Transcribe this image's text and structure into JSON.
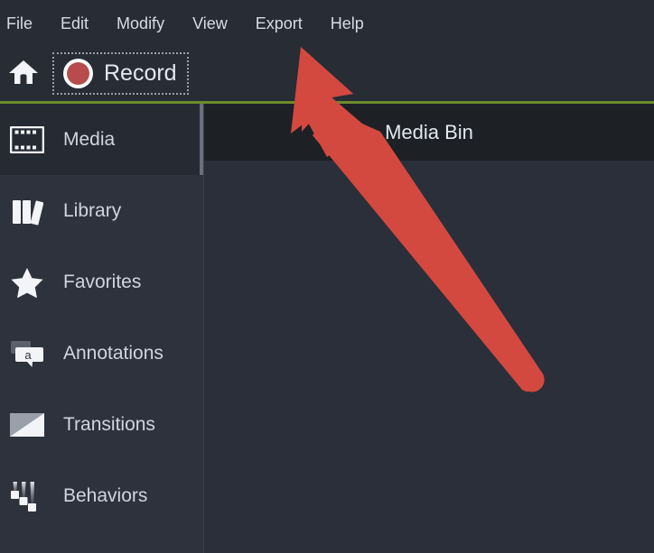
{
  "menubar": {
    "items": [
      {
        "label": "File"
      },
      {
        "label": "Edit"
      },
      {
        "label": "Modify"
      },
      {
        "label": "View"
      },
      {
        "label": "Export"
      },
      {
        "label": "Help"
      }
    ]
  },
  "toolbar": {
    "home_icon": "home-icon",
    "record_label": "Record",
    "record_icon": "record-circle-icon",
    "accent_color": "#6d8b2b"
  },
  "sidebar": {
    "items": [
      {
        "label": "Media",
        "icon": "film-strip-icon",
        "selected": true
      },
      {
        "label": "Library",
        "icon": "books-icon",
        "selected": false
      },
      {
        "label": "Favorites",
        "icon": "star-icon",
        "selected": false
      },
      {
        "label": "Annotations",
        "icon": "speech-bubble-a-icon",
        "selected": false
      },
      {
        "label": "Transitions",
        "icon": "diagonal-split-icon",
        "selected": false
      },
      {
        "label": "Behaviors",
        "icon": "motion-trails-icon",
        "selected": false
      }
    ]
  },
  "main": {
    "bin_title": "Media Bin"
  },
  "annotation": {
    "arrow_color": "#d4493f",
    "points_to": "Export"
  }
}
